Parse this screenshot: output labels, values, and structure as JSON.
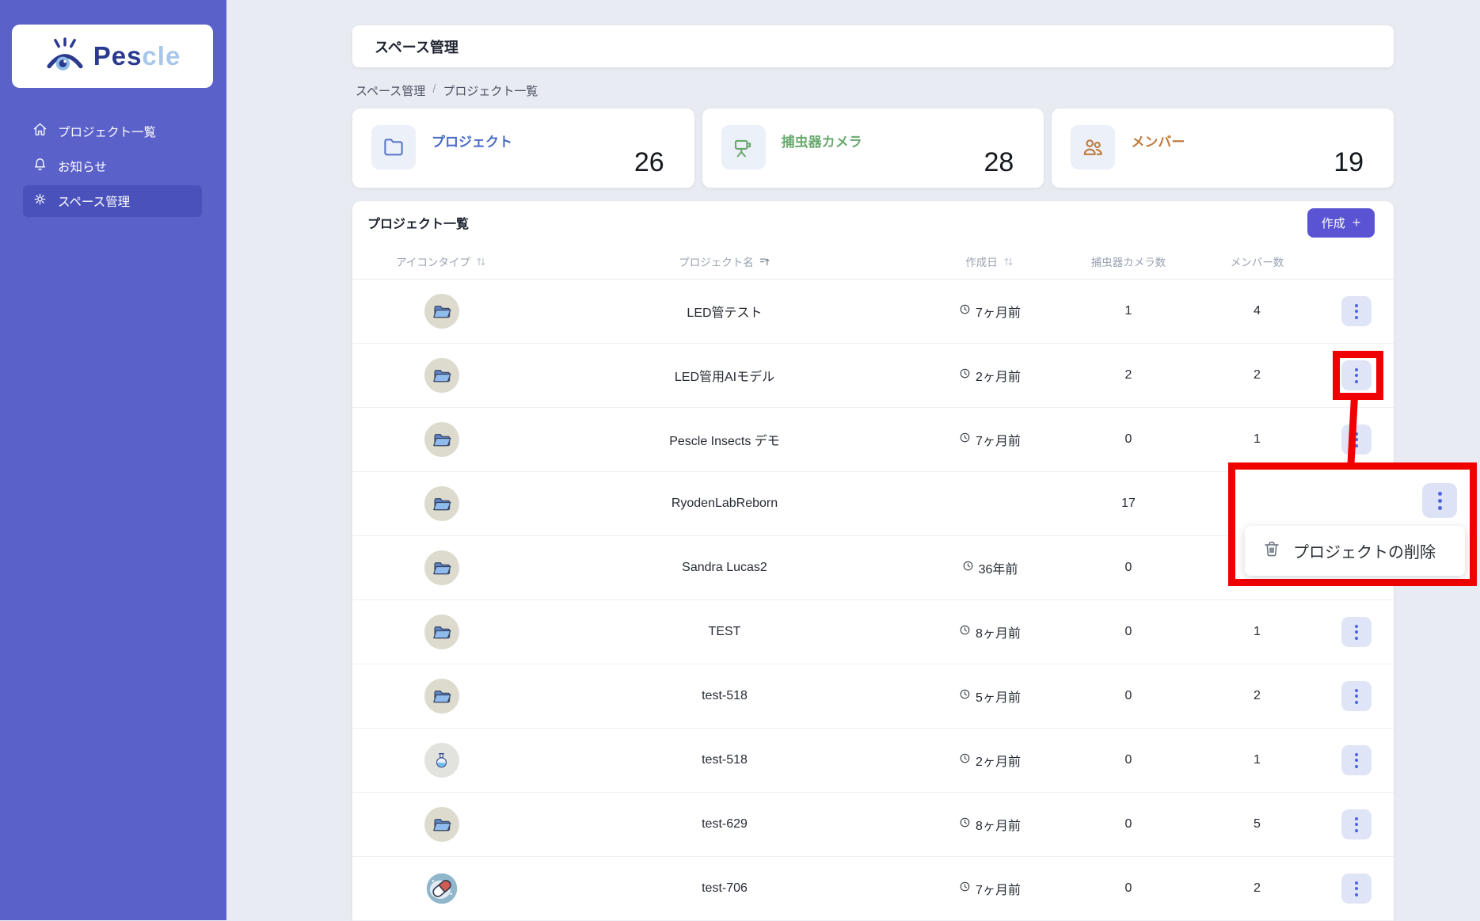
{
  "brand": {
    "word_primary": "Pes",
    "word_secondary": "cle"
  },
  "sidebar": {
    "items": [
      {
        "label": "プロジェクト一覧",
        "icon": "home-icon",
        "active": false
      },
      {
        "label": "お知らせ",
        "icon": "bell-icon",
        "active": false
      },
      {
        "label": "スペース管理",
        "icon": "gear-icon",
        "active": true
      }
    ]
  },
  "header": {
    "title": "スペース管理"
  },
  "breadcrumb": {
    "parent": "スペース管理",
    "separator": "/",
    "current": "プロジェクト一覧"
  },
  "stats": [
    {
      "label": "プロジェクト",
      "value": "26",
      "icon": "folder-icon",
      "color": "#4a6bc8"
    },
    {
      "label": "捕虫器カメラ",
      "value": "28",
      "icon": "trap-camera-icon",
      "color": "#69a96e"
    },
    {
      "label": "メンバー",
      "value": "19",
      "icon": "members-icon",
      "color": "#bf7b3d"
    }
  ],
  "table": {
    "title": "プロジェクト一覧",
    "create_button": {
      "label": "作成",
      "plus": "+"
    },
    "columns": [
      {
        "label": "アイコンタイプ",
        "sort": "both"
      },
      {
        "label": "プロジェクト名",
        "sort": "asc"
      },
      {
        "label": "作成日",
        "sort": "both"
      },
      {
        "label": "捕虫器カメラ数",
        "sort": "none"
      },
      {
        "label": "メンバー数",
        "sort": "none"
      },
      {
        "label": "",
        "sort": "none"
      }
    ],
    "rows": [
      {
        "icon": "folder",
        "name": "LED管テスト",
        "created": "7ヶ月前",
        "cameras": "1",
        "members": "4"
      },
      {
        "icon": "folder",
        "name": "LED管用AIモデル",
        "created": "2ヶ月前",
        "cameras": "2",
        "members": "2"
      },
      {
        "icon": "folder",
        "name": "Pescle Insects デモ",
        "created": "7ヶ月前",
        "cameras": "0",
        "members": "1"
      },
      {
        "icon": "folder",
        "name": "RyodenLabReborn",
        "created": "",
        "cameras": "17",
        "members": ""
      },
      {
        "icon": "folder",
        "name": "Sandra Lucas2",
        "created": "36年前",
        "cameras": "0",
        "members": ""
      },
      {
        "icon": "folder",
        "name": "TEST",
        "created": "8ヶ月前",
        "cameras": "0",
        "members": "1"
      },
      {
        "icon": "folder",
        "name": "test-518",
        "created": "5ヶ月前",
        "cameras": "0",
        "members": "2"
      },
      {
        "icon": "flask",
        "name": "test-518",
        "created": "2ヶ月前",
        "cameras": "0",
        "members": "1"
      },
      {
        "icon": "folder",
        "name": "test-629",
        "created": "8ヶ月前",
        "cameras": "0",
        "members": "5"
      },
      {
        "icon": "pill",
        "name": "test-706",
        "created": "7ヶ月前",
        "cameras": "0",
        "members": "2"
      }
    ]
  },
  "context_menu": {
    "items": [
      {
        "label": "プロジェクトの削除",
        "icon": "trash-icon"
      }
    ]
  },
  "annotation": {
    "color": "#f10000"
  }
}
